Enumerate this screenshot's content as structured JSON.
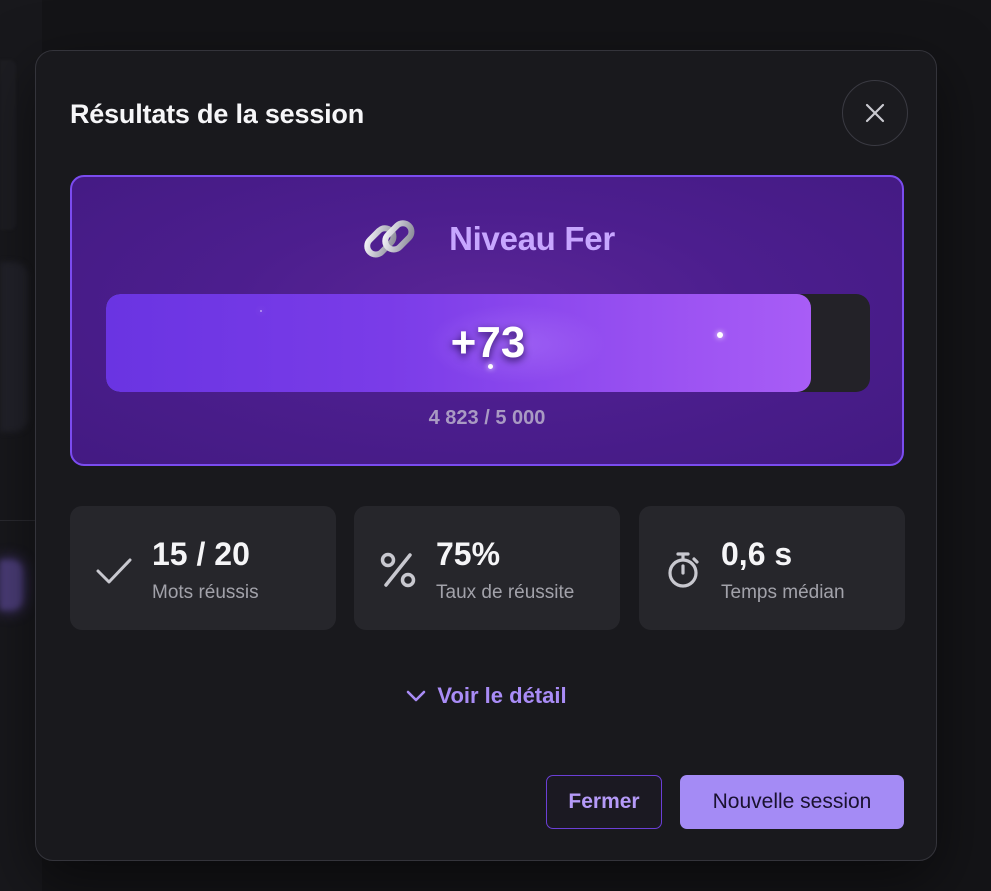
{
  "modal": {
    "title": "Résultats de la session",
    "close_icon": "close-icon"
  },
  "level": {
    "icon": "chain-link-icon",
    "name": "Niveau Fer",
    "gain": "+73",
    "progress_text": "4 823 / 5 000",
    "progress_fraction": 0.9646,
    "accent": "#7b4cf0"
  },
  "stats": [
    {
      "icon": "check-icon",
      "value": "15 / 20",
      "label": "Mots réussis"
    },
    {
      "icon": "percent-icon",
      "value": "75%",
      "label": "Taux de réussite"
    },
    {
      "icon": "stopwatch-icon",
      "value": "0,6 s",
      "label": "Temps médian"
    }
  ],
  "detail": {
    "icon": "chevron-down-icon",
    "label": "Voir le détail"
  },
  "footer": {
    "close_label": "Fermer",
    "new_session_label": "Nouvelle session"
  }
}
